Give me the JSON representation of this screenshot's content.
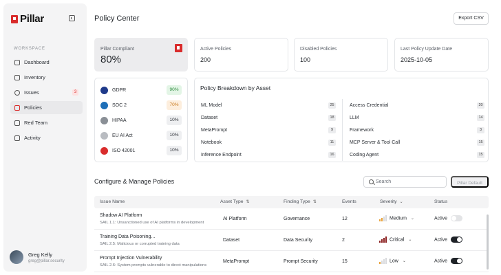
{
  "app": {
    "brand": "Pillar",
    "workspace_label": "WORKSPACE"
  },
  "sidebar": {
    "items": [
      {
        "label": "Dashboard",
        "icon": "grid-icon"
      },
      {
        "label": "Inventory",
        "icon": "box-icon"
      },
      {
        "label": "Issues",
        "icon": "bug-icon",
        "badge": "3"
      },
      {
        "label": "Policies",
        "icon": "document-icon",
        "active": true
      },
      {
        "label": "Red Team",
        "icon": "sword-icon"
      },
      {
        "label": "Activity",
        "icon": "chat-icon"
      }
    ]
  },
  "user": {
    "name": "Greg Kelly",
    "email": "greg@pillar.security"
  },
  "header": {
    "title": "Policy Center",
    "export_label": "Export CSV"
  },
  "stats": {
    "compliant": {
      "label": "Pillar Compliant",
      "value": "80%"
    },
    "active": {
      "label": "Active Policies",
      "value": "200"
    },
    "disabled": {
      "label": "Disabled Policies",
      "value": "100"
    },
    "last_update": {
      "label": "Last Policy Update Date",
      "value": "2025-10-05"
    }
  },
  "frameworks": [
    {
      "name": "GDPR",
      "pct": "90%",
      "bg": "#e3f5e6",
      "fg": "#2e8a3e",
      "logo": "#1f3a8a"
    },
    {
      "name": "SOC 2",
      "pct": "70%",
      "bg": "#fdeedd",
      "fg": "#c77618",
      "logo": "#1e6fb8"
    },
    {
      "name": "HIPAA",
      "pct": "10%",
      "bg": "#eeeff1",
      "fg": "#2b2f35",
      "logo": "#8a8f96"
    },
    {
      "name": "EU AI Act",
      "pct": "10%",
      "bg": "#eeeff1",
      "fg": "#2b2f35",
      "logo": "#b9bcc1"
    },
    {
      "name": "ISO 42001",
      "pct": "10%",
      "bg": "#eeeff1",
      "fg": "#2b2f35",
      "logo": "#d92c2c"
    }
  ],
  "breakdown": {
    "title": "Policy Breakdown by Asset",
    "left": [
      {
        "label": "ML Model",
        "count": "25"
      },
      {
        "label": "Dataset",
        "count": "18"
      },
      {
        "label": "MetaPrompt",
        "count": "9"
      },
      {
        "label": "Notebook",
        "count": "11"
      },
      {
        "label": "Inference Endpoint",
        "count": "16"
      }
    ],
    "right": [
      {
        "label": "Access Credential",
        "count": "20"
      },
      {
        "label": "LLM",
        "count": "14"
      },
      {
        "label": "Framework",
        "count": "3"
      },
      {
        "label": "MCP Server & Tool Call",
        "count": "15"
      },
      {
        "label": "Coding Agent",
        "count": "15"
      }
    ]
  },
  "manage": {
    "title": "Configure & Manage Policies",
    "search_placeholder": "Search",
    "default_label": "Pillar Default",
    "columns": {
      "issue": "Issue Name",
      "asset": "Asset Type",
      "finding": "Finding Type",
      "events": "Events",
      "severity": "Severity",
      "status": "Status"
    },
    "rows": [
      {
        "name": "Shadow AI Platform",
        "desc": "SAIL 1.1: Unsanctioned use of AI platforms in development",
        "asset": "AI Platform",
        "finding": "Governance",
        "events": "12",
        "severity": "Medium",
        "level": 2,
        "status": "Active",
        "on": false
      },
      {
        "name": "Training Data Poisoning...",
        "desc": "SAIL 2.5: Malicious or corrupted training data",
        "asset": "Dataset",
        "finding": "Data Security",
        "events": "2",
        "severity": "Critical",
        "level": 4,
        "status": "Active",
        "on": true
      },
      {
        "name": "Prompt Injection Vulnerability",
        "desc": "SAIL 2.6: System prompts vulnerable to direct manipulations",
        "asset": "MetaPrompt",
        "finding": "Prompt Security",
        "events": "15",
        "severity": "Low",
        "level": 1,
        "status": "Active",
        "on": true
      }
    ]
  },
  "colors": {
    "accent": "#d92c2c",
    "medium": "#e8a23a",
    "critical": "#8a1f1f",
    "low": "#e8a23a"
  }
}
